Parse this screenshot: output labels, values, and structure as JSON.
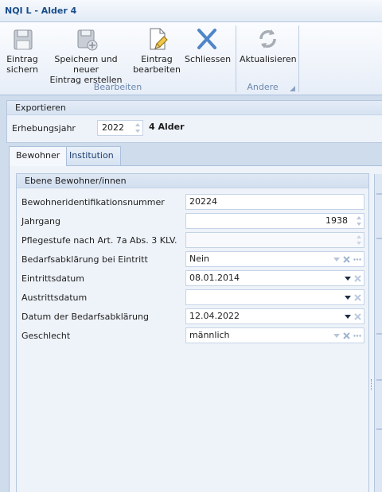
{
  "window": {
    "title": "NQI L - Alder 4"
  },
  "ribbon": {
    "groups": [
      {
        "label": "Bearbeiten",
        "buttons": [
          {
            "label": "Eintrag\nsichern",
            "icon": "save-icon"
          },
          {
            "label": "Speichern und neuer\nEintrag erstellen",
            "icon": "save-new-icon"
          },
          {
            "label": "Eintrag\nbearbeiten",
            "icon": "edit-document-icon"
          },
          {
            "label": "Schliessen",
            "icon": "close-icon"
          }
        ]
      },
      {
        "label": "Andere",
        "buttons": [
          {
            "label": "Aktualisieren",
            "icon": "refresh-icon"
          }
        ]
      }
    ]
  },
  "export": {
    "header": "Exportieren",
    "year_label": "Erhebungsjahr",
    "year_value": "2022",
    "alder_label": "4 Alder"
  },
  "tabs": [
    {
      "label": "Bewohner",
      "active": true
    },
    {
      "label": "Institution",
      "active": false
    }
  ],
  "panel": {
    "header": "Ebene Bewohner/innen",
    "fields": [
      {
        "label": "Bewohneridentifikationsnummer",
        "value": "20224",
        "type": "text"
      },
      {
        "label": "Jahrgang",
        "value": "1938",
        "type": "spin"
      },
      {
        "label": "Pflegestufe nach Art. 7a Abs. 3 KLV.",
        "value": "",
        "type": "spin-disabled"
      },
      {
        "label": "Bedarfsabklärung bei Eintritt",
        "value": "Nein",
        "type": "lookup"
      },
      {
        "label": "Eintrittsdatum",
        "value": "08.01.2014",
        "type": "date"
      },
      {
        "label": "Austrittsdatum",
        "value": "",
        "type": "date"
      },
      {
        "label": "Datum der Bedarfsabklärung",
        "value": "12.04.2022",
        "type": "date"
      },
      {
        "label": "Geschlecht",
        "value": "männlich",
        "type": "lookup"
      }
    ]
  },
  "colors": {
    "accent": "#1a4e8c",
    "ribbon_group_label": "#6b87ad",
    "clear_x": "#9fb4d0"
  }
}
